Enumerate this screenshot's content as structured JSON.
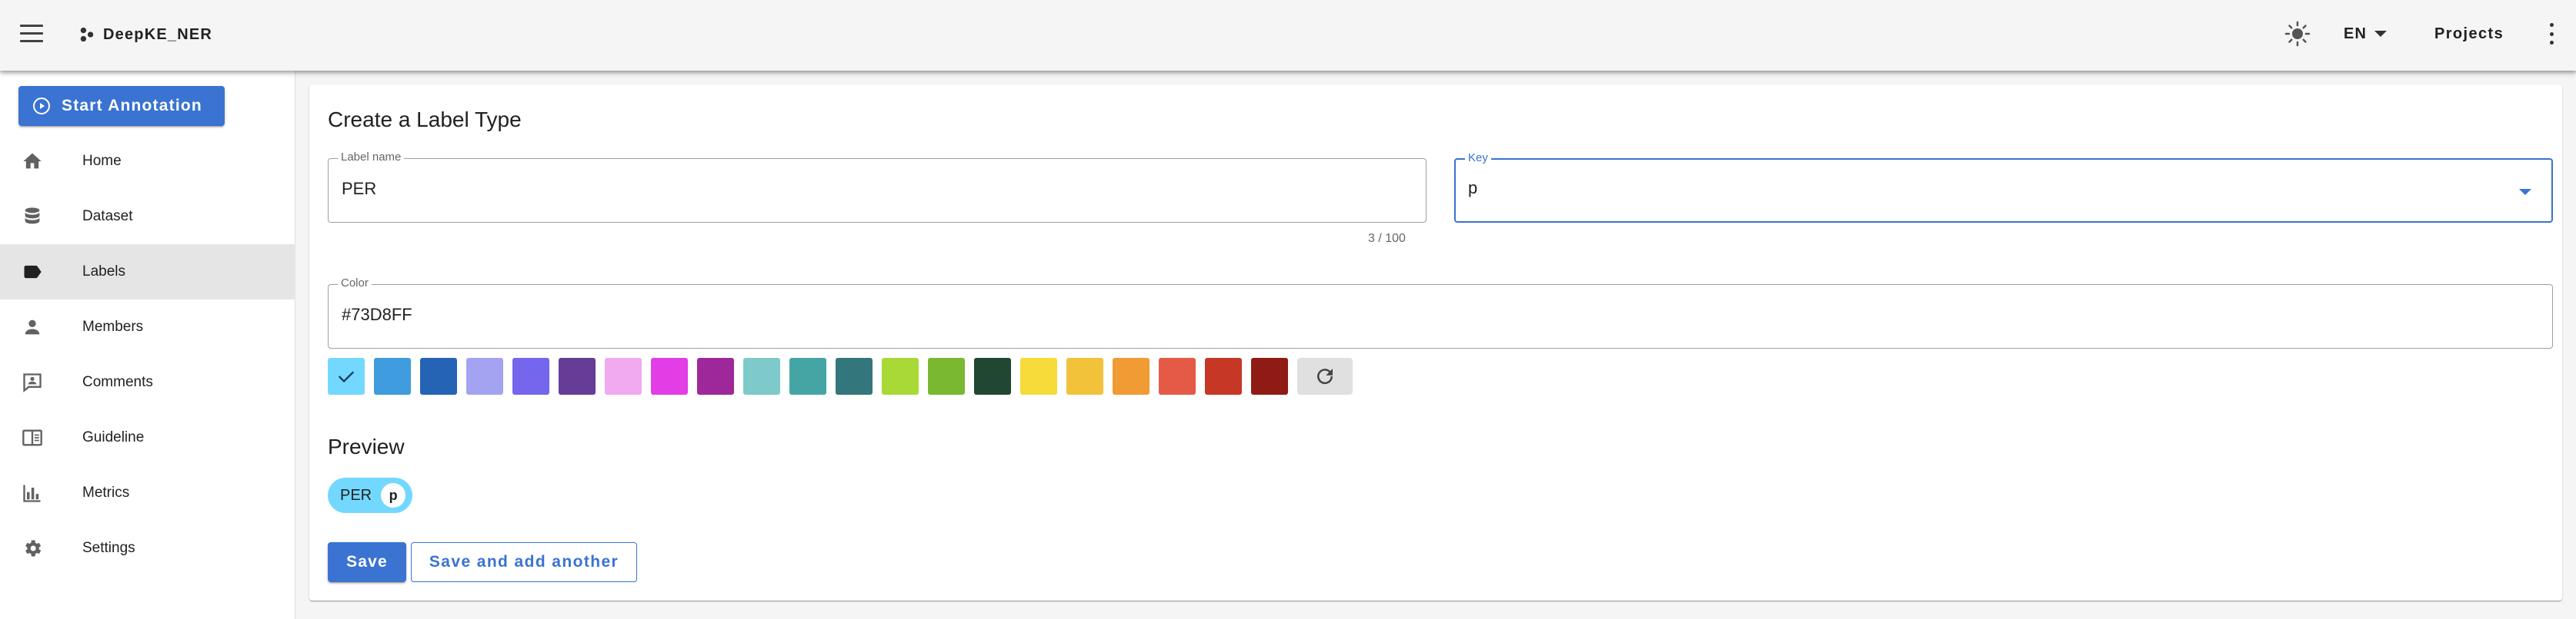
{
  "appbar": {
    "app_title": "DeepKE_NER",
    "language": "EN",
    "projects_label": "Projects",
    "icons": {
      "menu": "hamburger-icon",
      "logo": "molecule-logo-icon",
      "theme": "sun-icon",
      "more": "dots-vertical-icon"
    }
  },
  "sidebar": {
    "start_annotation": "Start Annotation",
    "items": [
      {
        "label": "Home",
        "icon": "home-icon"
      },
      {
        "label": "Dataset",
        "icon": "database-icon"
      },
      {
        "label": "Labels",
        "icon": "label-icon",
        "active": true
      },
      {
        "label": "Members",
        "icon": "account-icon"
      },
      {
        "label": "Comments",
        "icon": "comment-account-icon"
      },
      {
        "label": "Guideline",
        "icon": "book-open-icon"
      },
      {
        "label": "Metrics",
        "icon": "chart-bar-icon"
      },
      {
        "label": "Settings",
        "icon": "cog-icon"
      }
    ]
  },
  "form": {
    "title": "Create a Label Type",
    "label_name": {
      "label": "Label name",
      "value": "PER",
      "counter": "3 / 100"
    },
    "key": {
      "label": "Key",
      "value": "p"
    },
    "color": {
      "label": "Color",
      "value": "#73D8FF"
    },
    "swatches": [
      "#73D8FF",
      "#3F9CDE",
      "#2563B5",
      "#A4A3F2",
      "#7566EE",
      "#653C96",
      "#F1A9F0",
      "#E33DE6",
      "#9E2899",
      "#7EC9CA",
      "#45A5A5",
      "#33767B",
      "#A8D936",
      "#79B830",
      "#214733",
      "#F6DB3A",
      "#F2C23A",
      "#F09B33",
      "#E55A46",
      "#C73725",
      "#8F1C14"
    ],
    "selected_swatch": 0,
    "preview_title": "Preview",
    "preview_chip": {
      "text": "PER",
      "key": "p"
    },
    "save_label": "Save",
    "save_another_label": "Save and add another"
  }
}
